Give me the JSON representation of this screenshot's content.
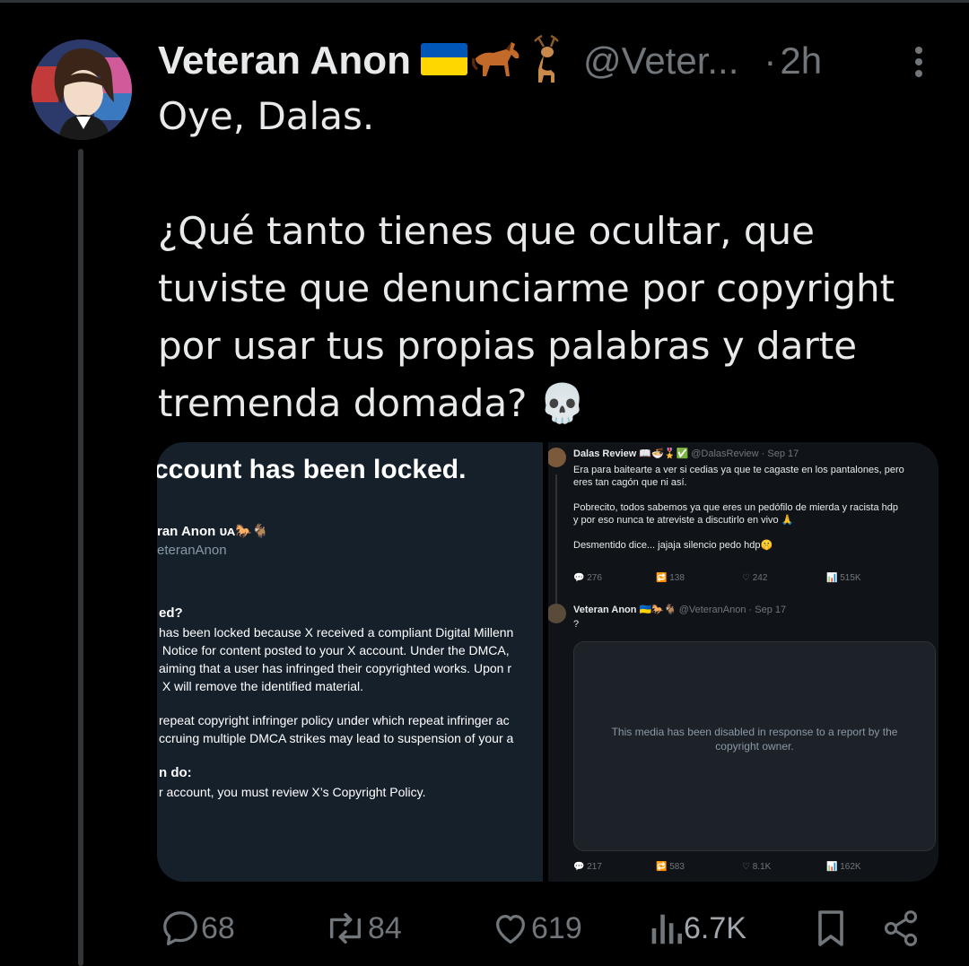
{
  "tweet": {
    "author_name": "Veteran Anon",
    "badges": [
      "ukraine-flag-icon",
      "horse-icon",
      "deer-icon"
    ],
    "handle": "@Veter...",
    "separator": "·",
    "time": "2h",
    "text": "Oye, Dalas.\n\n¿Qué tanto tienes que ocultar, que tuviste que denunciarme por copyright por usar tus propias palabras y darte tremenda domada? 💀"
  },
  "media_left": {
    "title": "ccount has been locked.",
    "account_name": "ran Anon ᴜᴀ🐎🐐",
    "account_handle": "eteranAnon",
    "section1_heading": "ed?",
    "section1_body": "has been locked because X received a compliant Digital Millenn\n Notice for content posted to your X account. Under the DMCA, \naiming that a user has infringed their copyrighted works. Upon r\n X will remove the identified material.",
    "section2_body": "repeat copyright infringer policy under which repeat infringer ac\nccruing multiple DMCA strikes may lead to suspension of your a",
    "section3_heading": "n do:",
    "section3_body": "r account, you must review X’s Copyright Policy."
  },
  "media_right": {
    "post1": {
      "name": "Dalas Review 📖🍜🎖️✅",
      "handle": "@DalasReview · Sep 17",
      "text": "Era para baitearte a ver si cedias ya que te cagaste en los pantalones, pero\neres tan cagón que ni así.\n\nPobrecito, todos sabemos ya que eres un pedófilo de mierda y racista hdp\ny por eso nunca te atreviste a discutirlo en vivo 🙏\n\nDesmentido dice... jajaja silencio pedo hdp🤫",
      "replies": "276",
      "reposts": "138",
      "likes": "242",
      "views": "515K"
    },
    "post2": {
      "name": "Veteran Anon 🇺🇦🐎🐐",
      "handle": "@VeteranAnon · Sep 17",
      "text": "?",
      "media_notice": "This media has been disabled in response to a report by the copyright owner.",
      "replies": "217",
      "reposts": "583",
      "likes": "8.1K",
      "views": "162K"
    }
  },
  "actions": {
    "replies": "68",
    "reposts": "84",
    "likes": "619",
    "views": "6.7K"
  }
}
